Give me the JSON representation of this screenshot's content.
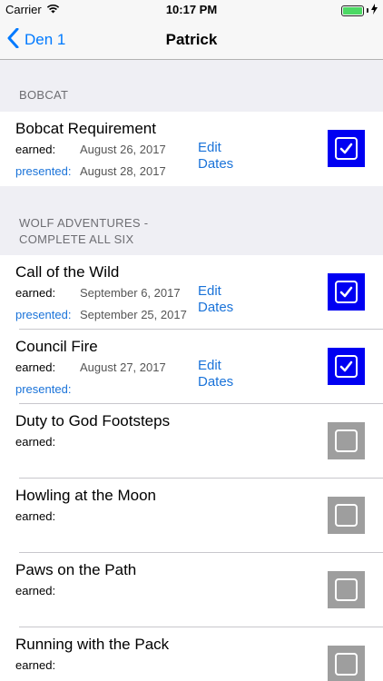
{
  "status_bar": {
    "carrier": "Carrier",
    "time": "10:17 PM",
    "icons": [
      "wifi-icon",
      "battery-icon",
      "charging-icon"
    ]
  },
  "nav": {
    "back_label": "Den 1",
    "title": "Patrick"
  },
  "labels": {
    "earned": "earned:",
    "presented": "presented:",
    "edit_line1": "Edit",
    "edit_line2": "Dates"
  },
  "sections": [
    {
      "header_line1": "BOBCAT",
      "header_line2": "",
      "rows": [
        {
          "title": "Bobcat Requirement",
          "earned_date": "August 26, 2017",
          "presented_date": "August 28, 2017",
          "checked": true
        }
      ]
    },
    {
      "header_line1": "WOLF ADVENTURES -",
      "header_line2": "COMPLETE ALL SIX",
      "rows": [
        {
          "title": "Call of the Wild",
          "earned_date": "September 6, 2017",
          "presented_date": "September 25, 2017",
          "checked": true
        },
        {
          "title": "Council Fire",
          "earned_date": "August 27, 2017",
          "presented_date": "",
          "checked": true
        },
        {
          "title": "Duty to God Footsteps",
          "earned_date": "",
          "presented_date": "",
          "checked": false
        },
        {
          "title": "Howling at the Moon",
          "earned_date": "",
          "presented_date": "",
          "checked": false
        },
        {
          "title": "Paws on the Path",
          "earned_date": "",
          "presented_date": "",
          "checked": false
        },
        {
          "title": "Running with the Pack",
          "earned_date": "",
          "presented_date": "",
          "checked": false
        }
      ]
    }
  ],
  "colors": {
    "accent": "#007aff",
    "checked_fill": "#0000f2",
    "unchecked_fill": "#9e9e9e",
    "battery_fill": "#4cd964"
  }
}
